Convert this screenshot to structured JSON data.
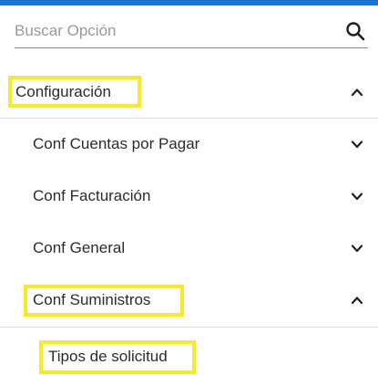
{
  "accent_color": "#1976d2",
  "highlight_color": "#f7ea28",
  "search": {
    "placeholder": "Buscar Opción",
    "value": "",
    "icon": "search-icon"
  },
  "menu": {
    "section": {
      "label": "Configuración",
      "expanded": true,
      "chevron": "chevron-up-icon"
    },
    "items": [
      {
        "label": "Conf Cuentas por Pagar",
        "expanded": false,
        "chevron": "chevron-down-icon"
      },
      {
        "label": "Conf Facturación",
        "expanded": false,
        "chevron": "chevron-down-icon"
      },
      {
        "label": "Conf General",
        "expanded": false,
        "chevron": "chevron-down-icon"
      },
      {
        "label": "Conf Suministros",
        "expanded": true,
        "chevron": "chevron-up-icon"
      }
    ],
    "subitems": [
      {
        "label": "Tipos de solicitud"
      }
    ]
  }
}
